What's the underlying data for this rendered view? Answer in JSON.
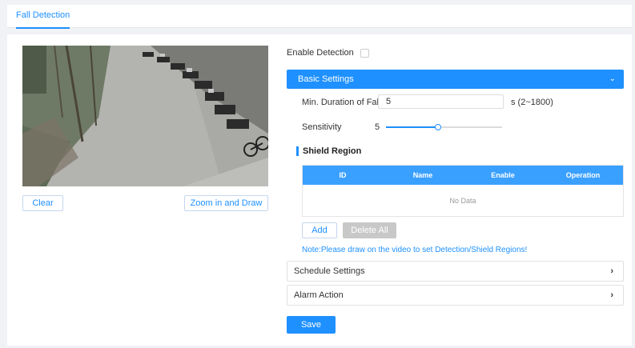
{
  "tabs": [
    {
      "label": "Fall Detection",
      "active": true
    }
  ],
  "video": {
    "controls": {
      "clear_label": "Clear",
      "zoom_draw_label": "Zoom in and Draw"
    }
  },
  "enable_detection": {
    "label": "Enable Detection",
    "checked": false
  },
  "basic_settings": {
    "title": "Basic Settings",
    "expanded": true,
    "min_duration": {
      "label": "Min. Duration of Fall",
      "value": "5",
      "unit": "s (2~1800)"
    },
    "sensitivity": {
      "label": "Sensitivity",
      "value": "5",
      "level_fraction": 0.45
    }
  },
  "shield_region": {
    "title": "Shield Region",
    "columns": [
      "ID",
      "Name",
      "Enable",
      "Operation"
    ],
    "rows": [],
    "empty_text": "No Data",
    "add_label": "Add",
    "delete_all_label": "Delete All",
    "note": "Note:Please draw on the video to set Detection/Shield Regions!"
  },
  "schedule_settings": {
    "title": "Schedule Settings"
  },
  "alarm_action": {
    "title": "Alarm Action"
  },
  "save_label": "Save",
  "colors": {
    "accent": "#1e90ff",
    "table_header": "#3aa0ff",
    "disabled": "#c8c8c8"
  },
  "icons": {
    "expanded": "chevron-down-icon",
    "collapsed": "chevron-right-icon"
  }
}
